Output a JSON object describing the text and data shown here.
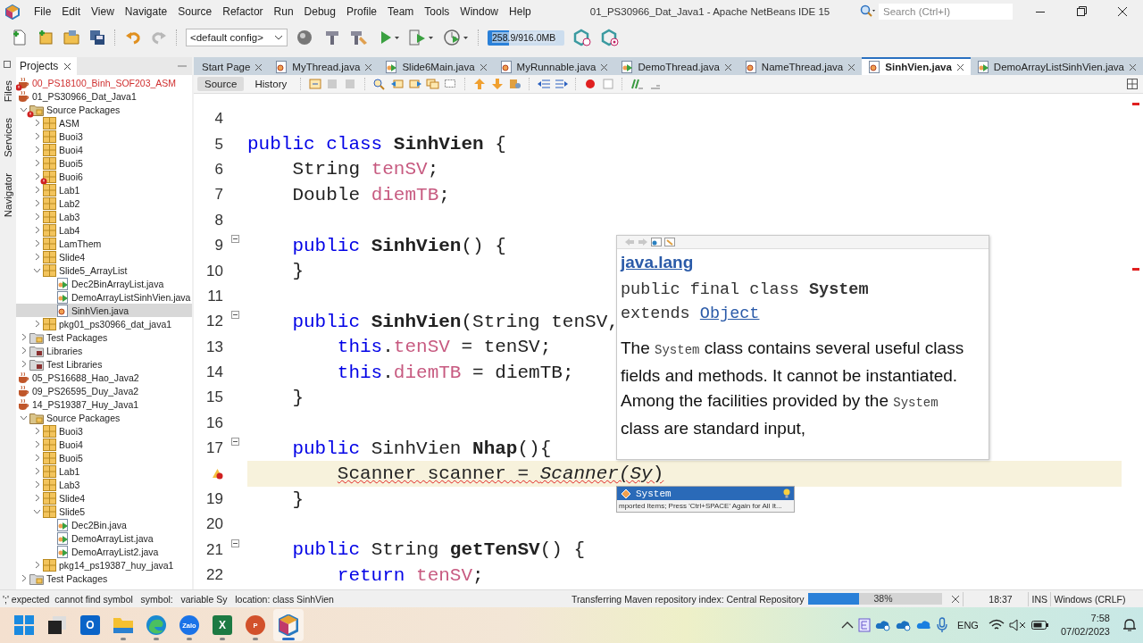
{
  "window": {
    "title": "01_PS30966_Dat_Java1 - Apache NetBeans IDE 15",
    "search_placeholder": "Search (Ctrl+I)"
  },
  "menu": [
    "File",
    "Edit",
    "View",
    "Navigate",
    "Source",
    "Refactor",
    "Run",
    "Debug",
    "Profile",
    "Team",
    "Tools",
    "Window",
    "Help"
  ],
  "toolbar": {
    "config": "<default config>",
    "memory": {
      "reading": "258.9/916.0MB",
      "level": 0.28
    }
  },
  "side_tabs": [
    "Files",
    "Services",
    "Navigator"
  ],
  "projects_panel": {
    "title": "Projects",
    "tree": [
      {
        "label": "00_PS18100_Binh_SOF203_ASM",
        "kind": "project",
        "error": true,
        "selected": false
      },
      {
        "label": "01_PS30966_Dat_Java1",
        "kind": "project",
        "error": false,
        "selected": false,
        "children": [
          {
            "label": "Source Packages",
            "kind": "sources",
            "expanded": true,
            "error": true,
            "selected": false,
            "children": [
              {
                "label": "ASM",
                "kind": "package",
                "expanded": false,
                "error": false,
                "selected": false
              },
              {
                "label": "Buoi3",
                "kind": "package",
                "expanded": false,
                "error": false,
                "selected": false
              },
              {
                "label": "Buoi4",
                "kind": "package",
                "expanded": false,
                "error": false,
                "selected": false
              },
              {
                "label": "Buoi5",
                "kind": "package",
                "expanded": false,
                "error": false,
                "selected": false
              },
              {
                "label": "Buoi6",
                "kind": "package",
                "expanded": false,
                "error": true,
                "selected": false
              },
              {
                "label": "Lab1",
                "kind": "package",
                "expanded": false,
                "error": false,
                "selected": false
              },
              {
                "label": "Lab2",
                "kind": "package",
                "expanded": false,
                "error": false,
                "selected": false
              },
              {
                "label": "Lab3",
                "kind": "package",
                "expanded": false,
                "error": false,
                "selected": false
              },
              {
                "label": "Lab4",
                "kind": "package",
                "expanded": false,
                "error": false,
                "selected": false
              },
              {
                "label": "LamThem",
                "kind": "package",
                "expanded": false,
                "error": false,
                "selected": false
              },
              {
                "label": "Slide4",
                "kind": "package",
                "expanded": false,
                "error": false,
                "selected": false
              },
              {
                "label": "Slide5_ArrayList",
                "kind": "package",
                "expanded": true,
                "error": false,
                "selected": false,
                "children": [
                  {
                    "label": "Dec2BinArrayList.java",
                    "kind": "runnable",
                    "error": false,
                    "selected": false
                  },
                  {
                    "label": "DemoArrayListSinhVien.java",
                    "kind": "runnable",
                    "error": false,
                    "selected": false
                  },
                  {
                    "label": "SinhVien.java",
                    "kind": "class",
                    "error": false,
                    "selected": true
                  }
                ]
              },
              {
                "label": "pkg01_ps30966_dat_java1",
                "kind": "package",
                "expanded": false,
                "error": false,
                "selected": false
              }
            ]
          },
          {
            "label": "Test Packages",
            "kind": "tests",
            "expanded": false,
            "error": false,
            "selected": false
          },
          {
            "label": "Libraries",
            "kind": "libraries",
            "expanded": false,
            "error": false,
            "selected": false
          },
          {
            "label": "Test Libraries",
            "kind": "libraries",
            "expanded": false,
            "error": false,
            "selected": false
          }
        ]
      },
      {
        "label": "05_PS16688_Hao_Java2",
        "kind": "project",
        "error": false,
        "selected": false
      },
      {
        "label": "09_PS26595_Duy_Java2",
        "kind": "project",
        "error": false,
        "selected": false
      },
      {
        "label": "14_PS19387_Huy_Java1",
        "kind": "project",
        "error": false,
        "selected": false,
        "children": [
          {
            "label": "Source Packages",
            "kind": "sources",
            "expanded": true,
            "error": false,
            "selected": false,
            "children": [
              {
                "label": "Buoi3",
                "kind": "package",
                "expanded": false,
                "error": false,
                "selected": false
              },
              {
                "label": "Buoi4",
                "kind": "package",
                "expanded": false,
                "error": false,
                "selected": false
              },
              {
                "label": "Buoi5",
                "kind": "package",
                "expanded": false,
                "error": false,
                "selected": false
              },
              {
                "label": "Lab1",
                "kind": "package",
                "expanded": false,
                "error": false,
                "selected": false
              },
              {
                "label": "Lab3",
                "kind": "package",
                "expanded": false,
                "error": false,
                "selected": false
              },
              {
                "label": "Slide4",
                "kind": "package",
                "expanded": false,
                "error": false,
                "selected": false
              },
              {
                "label": "Slide5",
                "kind": "package",
                "expanded": true,
                "error": false,
                "selected": false,
                "children": [
                  {
                    "label": "Dec2Bin.java",
                    "kind": "runnable",
                    "error": false,
                    "selected": false
                  },
                  {
                    "label": "DemoArrayList.java",
                    "kind": "runnable",
                    "error": false,
                    "selected": false
                  },
                  {
                    "label": "DemoArrayList2.java",
                    "kind": "runnable",
                    "error": false,
                    "selected": false
                  }
                ]
              },
              {
                "label": "pkg14_ps19387_huy_java1",
                "kind": "package",
                "expanded": false,
                "error": false,
                "selected": false
              }
            ]
          },
          {
            "label": "Test Packages",
            "kind": "tests",
            "expanded": false,
            "error": false,
            "selected": false
          }
        ]
      }
    ]
  },
  "editor": {
    "tabs": [
      {
        "label": "Start Page",
        "kind": "page",
        "selected": false
      },
      {
        "label": "MyThread.java",
        "kind": "class",
        "selected": false
      },
      {
        "label": "Slide6Main.java",
        "kind": "runnable",
        "selected": false
      },
      {
        "label": "MyRunnable.java",
        "kind": "class",
        "selected": false
      },
      {
        "label": "DemoThread.java",
        "kind": "runnable",
        "selected": false
      },
      {
        "label": "NameThread.java",
        "kind": "class",
        "selected": false
      },
      {
        "label": "SinhVien.java",
        "kind": "class",
        "selected": true
      },
      {
        "label": "DemoArrayListSinhVien.java",
        "kind": "runnable",
        "selected": false
      }
    ],
    "views": [
      {
        "label": "Source",
        "selected": true
      },
      {
        "label": "History",
        "selected": false
      }
    ],
    "lines": [
      {
        "number": "4",
        "foldable": false,
        "error": false,
        "current": false
      },
      {
        "number": "5",
        "foldable": false,
        "error": false,
        "current": false,
        "tokens": [
          {
            "kind": "kw",
            "text": "public class "
          },
          {
            "kind": "name",
            "text": "SinhVien"
          },
          {
            "kind": "plain",
            "text": " {"
          }
        ]
      },
      {
        "number": "6",
        "foldable": false,
        "error": false,
        "current": false,
        "tokens": [
          {
            "kind": "plain",
            "text": "    String "
          },
          {
            "kind": "field",
            "text": "tenSV"
          },
          {
            "kind": "plain",
            "text": ";"
          }
        ]
      },
      {
        "number": "7",
        "foldable": false,
        "error": false,
        "current": false,
        "tokens": [
          {
            "kind": "plain",
            "text": "    Double "
          },
          {
            "kind": "field",
            "text": "diemTB"
          },
          {
            "kind": "plain",
            "text": ";"
          }
        ]
      },
      {
        "number": "8",
        "foldable": false,
        "error": false,
        "current": false
      },
      {
        "number": "9",
        "foldable": true,
        "error": false,
        "current": false,
        "tokens": [
          {
            "kind": "kw",
            "text": "    public "
          },
          {
            "kind": "name",
            "text": "SinhVien"
          },
          {
            "kind": "plain",
            "text": "() {"
          }
        ]
      },
      {
        "number": "10",
        "foldable": false,
        "error": false,
        "current": false,
        "tokens": [
          {
            "kind": "plain",
            "text": "    }"
          }
        ]
      },
      {
        "number": "11",
        "foldable": false,
        "error": false,
        "current": false
      },
      {
        "number": "12",
        "foldable": true,
        "error": false,
        "current": false,
        "tokens": [
          {
            "kind": "kw",
            "text": "    public "
          },
          {
            "kind": "name",
            "text": "SinhVien"
          },
          {
            "kind": "plain",
            "text": "(String tenSV,"
          }
        ]
      },
      {
        "number": "13",
        "foldable": false,
        "error": false,
        "current": false,
        "tokens": [
          {
            "kind": "kw",
            "text": "        this"
          },
          {
            "kind": "plain",
            "text": "."
          },
          {
            "kind": "field",
            "text": "tenSV"
          },
          {
            "kind": "plain",
            "text": " = tenSV;"
          }
        ]
      },
      {
        "number": "14",
        "foldable": false,
        "error": false,
        "current": false,
        "tokens": [
          {
            "kind": "kw",
            "text": "        this"
          },
          {
            "kind": "plain",
            "text": "."
          },
          {
            "kind": "field",
            "text": "diemTB"
          },
          {
            "kind": "plain",
            "text": " = diemTB;"
          }
        ]
      },
      {
        "number": "15",
        "foldable": false,
        "error": false,
        "current": false,
        "tokens": [
          {
            "kind": "plain",
            "text": "    }"
          }
        ]
      },
      {
        "number": "16",
        "foldable": false,
        "error": false,
        "current": false
      },
      {
        "number": "17",
        "foldable": true,
        "error": false,
        "current": false,
        "tokens": [
          {
            "kind": "kw",
            "text": "    public "
          },
          {
            "kind": "plain",
            "text": "SinhVien "
          },
          {
            "kind": "name",
            "text": "Nhap"
          },
          {
            "kind": "plain",
            "text": "(){"
          }
        ]
      },
      {
        "foldable": false,
        "error": true,
        "current": true,
        "tokens": [
          {
            "kind": "err",
            "text": "        Scanner scanner = "
          },
          {
            "kind": "err-italic",
            "text": "Scanner(Sy"
          },
          {
            "kind": "err",
            "text": ")"
          }
        ]
      },
      {
        "number": "19",
        "foldable": false,
        "error": false,
        "current": false,
        "tokens": [
          {
            "kind": "plain",
            "text": "    }"
          }
        ]
      },
      {
        "number": "20",
        "foldable": false,
        "error": false,
        "current": false
      },
      {
        "number": "21",
        "foldable": true,
        "error": false,
        "current": false,
        "tokens": [
          {
            "kind": "kw",
            "text": "    public "
          },
          {
            "kind": "plain",
            "text": "String "
          },
          {
            "kind": "name",
            "text": "getTenSV"
          },
          {
            "kind": "plain",
            "text": "() {"
          }
        ]
      },
      {
        "number": "22",
        "foldable": false,
        "error": false,
        "current": false,
        "tokens": [
          {
            "kind": "kw",
            "text": "        return "
          },
          {
            "kind": "field",
            "text": "tenSV"
          },
          {
            "kind": "plain",
            "text": ";"
          }
        ]
      }
    ]
  },
  "javadoc": {
    "package": "java.lang",
    "signature": "public final class **System**",
    "extends": "extends",
    "superclass": "Object",
    "description": [
      {
        "kind": "text",
        "text": "The "
      },
      {
        "kind": "code",
        "text": "System"
      },
      {
        "kind": "text",
        "text": " class contains several useful class fields and methods. It cannot be instantiated. Among the facilities provided by the "
      },
      {
        "kind": "code",
        "text": "System"
      },
      {
        "kind": "text",
        "text": " class are standard input,"
      }
    ]
  },
  "completion": {
    "items": [
      {
        "label": "System",
        "selected": true
      }
    ],
    "footer": "mported Items; Press 'Ctrl+SPACE' Again for All It..."
  },
  "status_bar": {
    "message": "';' expected  cannot find symbol   symbol:   variable Sy   location: class SinhVien",
    "task": "Transferring Maven repository index: Central Repository",
    "progress": {
      "level": 0.38,
      "reading": "38%"
    },
    "position": "18:37",
    "mode": "INS",
    "line_endings": "Windows (CRLF)"
  },
  "taskbar": {
    "apps": [
      {
        "kind": "start",
        "running": false,
        "selected": false
      },
      {
        "kind": "taskview",
        "running": false,
        "selected": false
      },
      {
        "kind": "outlook",
        "glyph": "O",
        "running": false,
        "selected": false
      },
      {
        "kind": "explorer",
        "running": true,
        "selected": false
      },
      {
        "kind": "edge",
        "running": true,
        "selected": false
      },
      {
        "kind": "zalo",
        "glyph": "Zalo",
        "running": true,
        "selected": false
      },
      {
        "kind": "excel",
        "glyph": "X",
        "running": true,
        "selected": false
      },
      {
        "kind": "powerpoint",
        "glyph": "P",
        "running": true,
        "selected": false
      },
      {
        "kind": "netbeans",
        "running": true,
        "selected": true
      }
    ],
    "language": "ENG",
    "time": "7:58",
    "date": "07/02/2023"
  }
}
